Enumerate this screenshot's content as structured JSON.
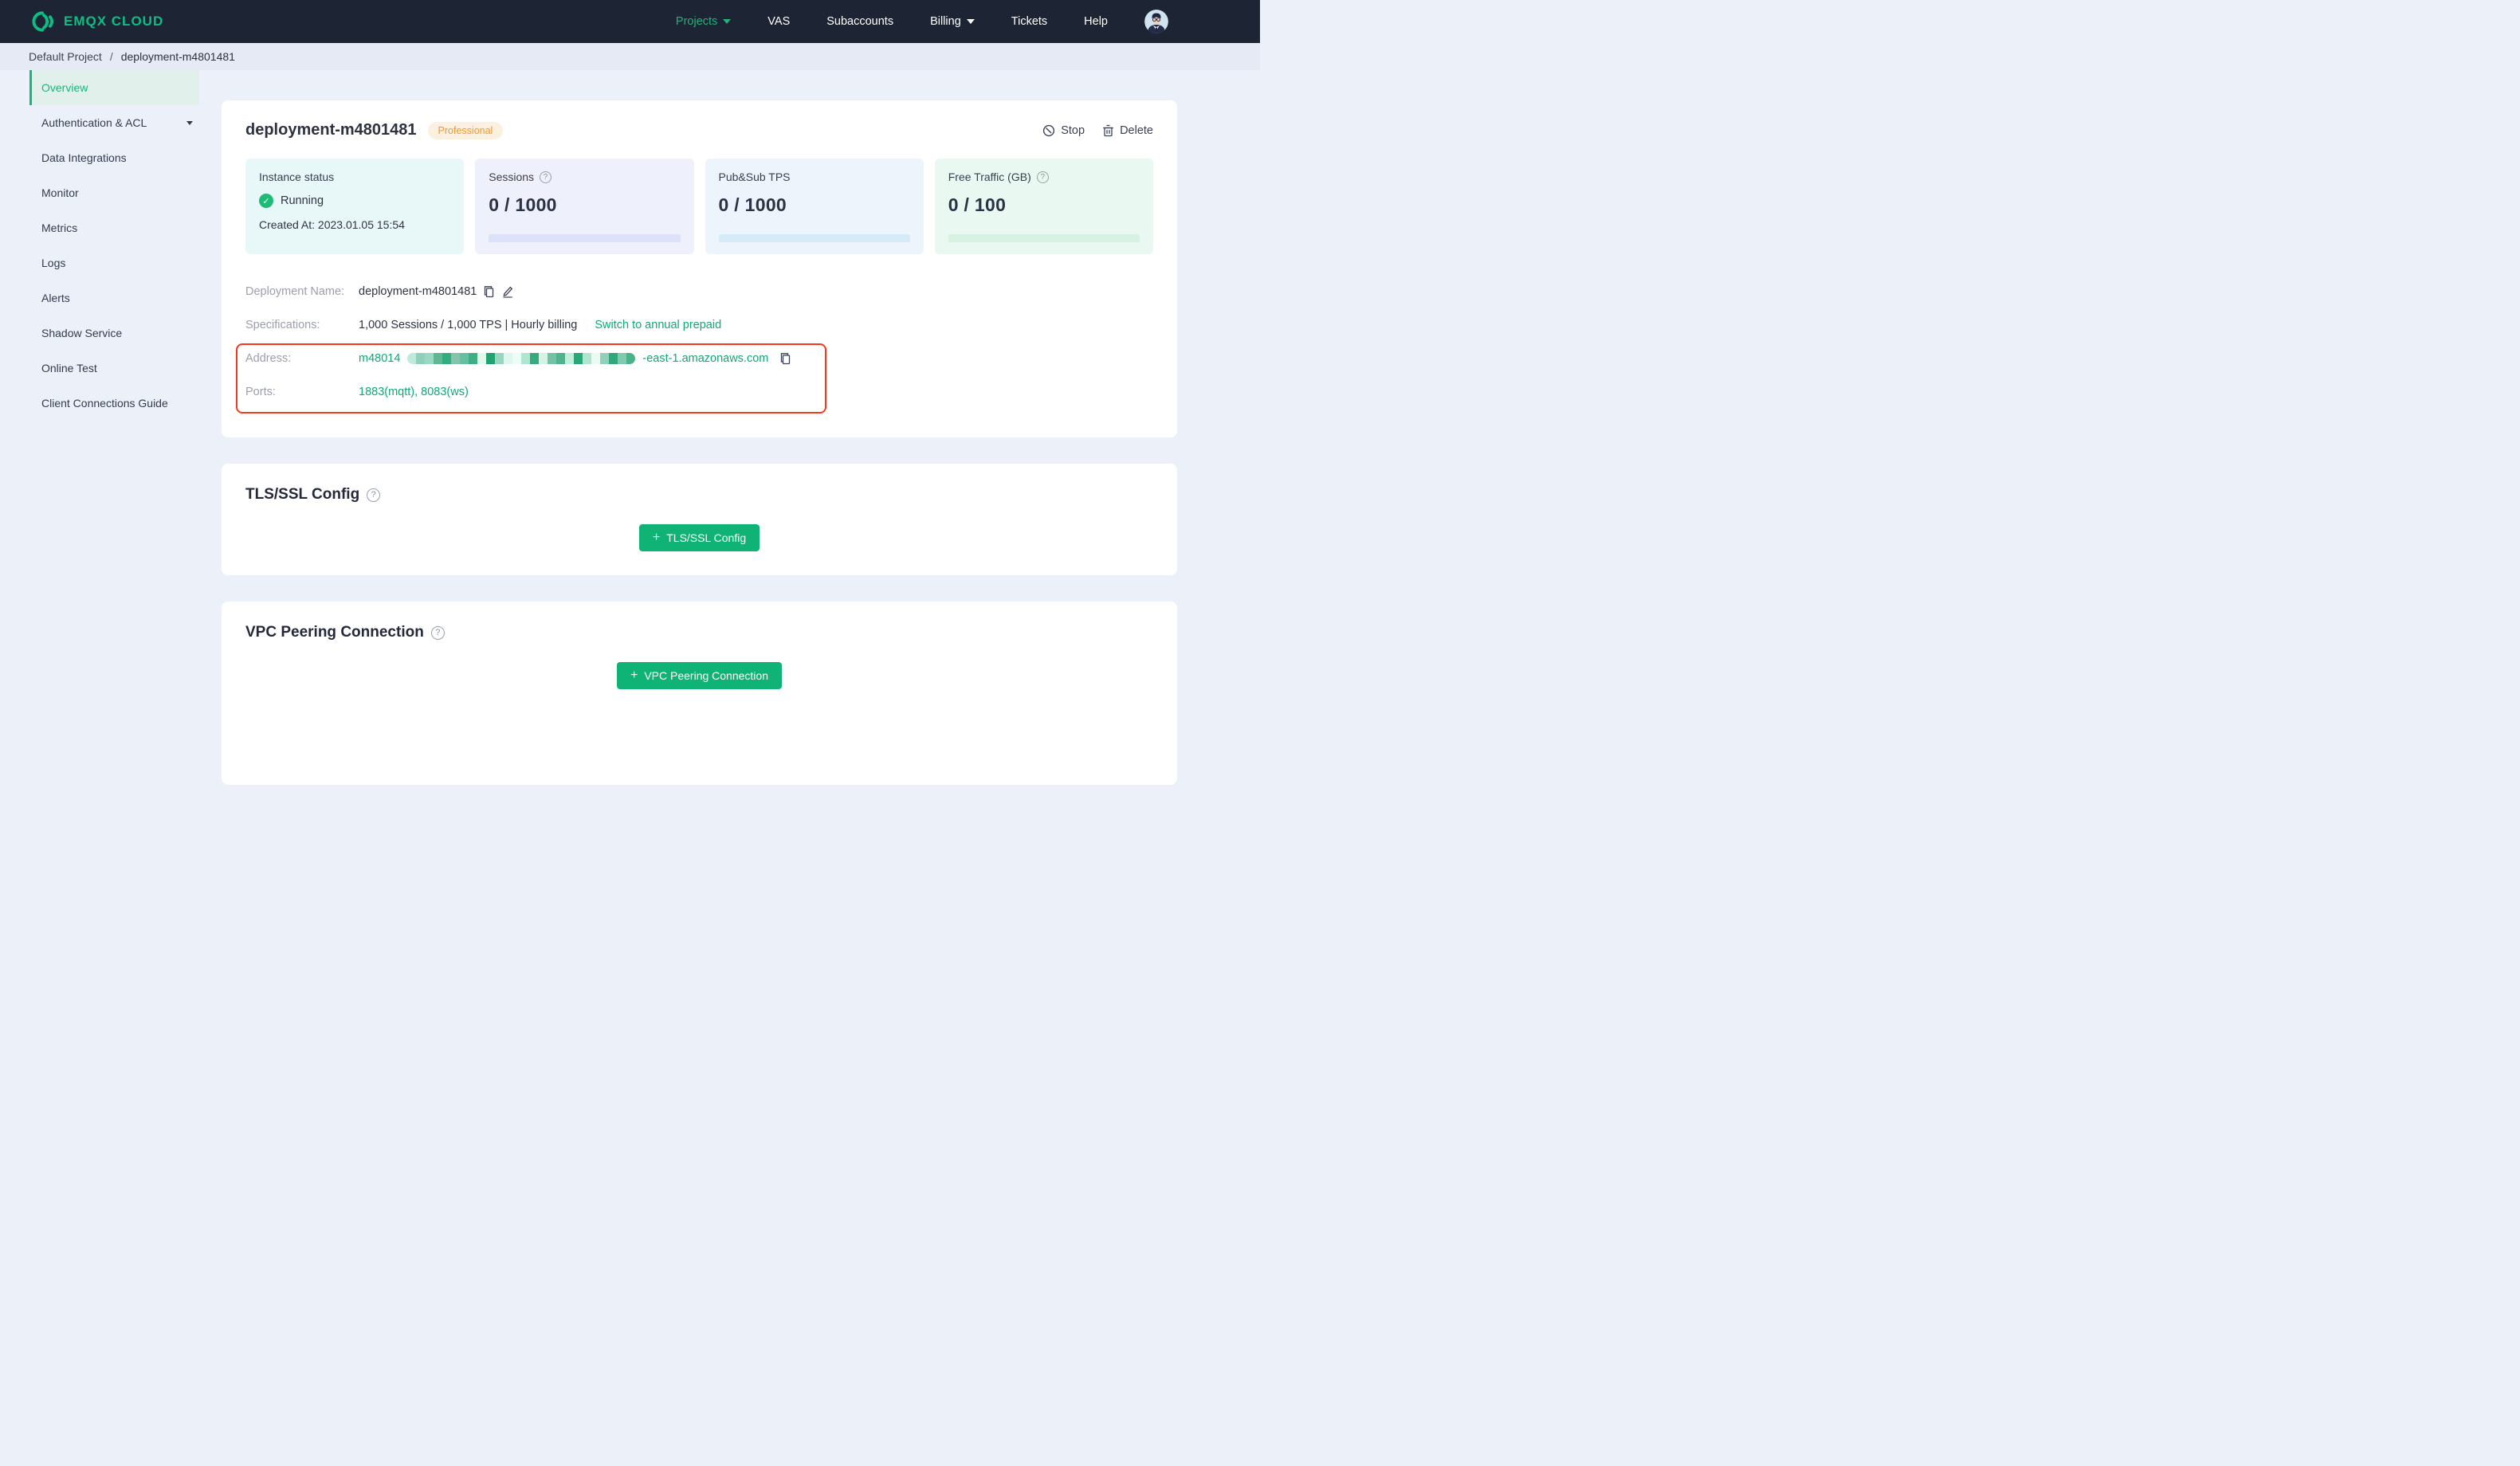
{
  "navbar": {
    "brand": "EMQX CLOUD",
    "items": [
      {
        "label": "Projects"
      },
      {
        "label": "VAS"
      },
      {
        "label": "Subaccounts"
      },
      {
        "label": "Billing"
      },
      {
        "label": "Tickets"
      },
      {
        "label": "Help"
      }
    ]
  },
  "breadcrumb": {
    "project": "Default Project",
    "separator": "/",
    "current": "deployment-m4801481"
  },
  "sidebar": {
    "items": [
      {
        "label": "Overview"
      },
      {
        "label": "Authentication & ACL"
      },
      {
        "label": "Data Integrations"
      },
      {
        "label": "Monitor"
      },
      {
        "label": "Metrics"
      },
      {
        "label": "Logs"
      },
      {
        "label": "Alerts"
      },
      {
        "label": "Shadow Service"
      },
      {
        "label": "Online Test"
      },
      {
        "label": "Client Connections Guide"
      }
    ]
  },
  "overview": {
    "title": "deployment-m4801481",
    "badge": "Professional",
    "actions": {
      "stop": "Stop",
      "delete": "Delete"
    },
    "stats": [
      {
        "label": "Instance status",
        "status": "Running",
        "created": "Created At: 2023.01.05 15:54"
      },
      {
        "label": "Sessions",
        "value": "0 / 1000"
      },
      {
        "label": "Pub&Sub TPS",
        "value": "0 / 1000"
      },
      {
        "label": "Free Traffic (GB)",
        "value": "0 / 100"
      }
    ],
    "details": {
      "deployment_name_label": "Deployment Name:",
      "deployment_name": "deployment-m4801481",
      "specifications_label": "Specifications:",
      "specifications": "1,000 Sessions / 1,000 TPS | Hourly billing",
      "switch_link": "Switch to annual prepaid",
      "address_label": "Address:",
      "address_prefix": "m48014",
      "address_suffix": "-east-1.amazonaws.com",
      "ports_label": "Ports:",
      "ports": "1883(mqtt), 8083(ws)"
    }
  },
  "tls": {
    "heading": "TLS/SSL Config",
    "button_label": "TLS/SSL Config",
    "button_plus": "+"
  },
  "vpc": {
    "heading": "VPC Peering Connection",
    "button_label": "VPC Peering Connection",
    "button_plus": "+"
  },
  "help_glyph": "?",
  "check_glyph": "✓",
  "colors": {
    "navbar_bg": "#1d2433",
    "brand_green": "#0bbf84",
    "menu_active_green": "#27ae7b",
    "page_bg": "#ebf0f9",
    "breadcrumb_bg": "#e6eaf5",
    "accent_green": "#0fa875",
    "button_green": "#10b376",
    "sidebar_active_bg": "#e2f0eb",
    "annotation_red": "#f5391f",
    "badge_bg": "#fcf1e0",
    "badge_text": "#f1992d",
    "stat_instance_bg": "#e8f7f7",
    "stat_sessions_bg": "#eef0fb",
    "stat_pubsub_bg": "#edf4fb",
    "stat_traffic_bg": "#e9f9f1",
    "bar_sessions": "#dde2f8",
    "bar_pubsub": "#d6ebf8",
    "bar_traffic": "#d7f2e3"
  },
  "mosaic": {
    "colors": [
      "#bfeadb",
      "#8fd0b8",
      "#9bd8c3",
      "#5fb894",
      "#2fae7e",
      "#86c3ab",
      "#63c0a0",
      "#3fae85",
      "#e2f8ef",
      "#22a273",
      "#97d6c1",
      "#dff6ec",
      "#ecfcf6",
      "#aee6d2",
      "#35aa7e",
      "#d6f2e6",
      "#74c2a4",
      "#4fb38d",
      "#c3eddd",
      "#2aa678",
      "#b2e4d1",
      "#eafbf4",
      "#90cfba",
      "#31a87c",
      "#7fcab0",
      "#49b28a"
    ]
  }
}
